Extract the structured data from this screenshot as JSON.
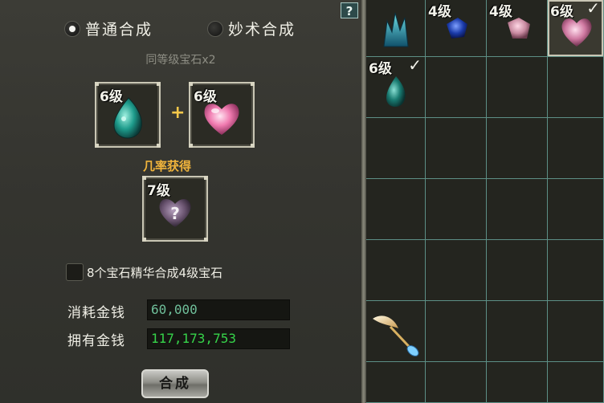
{
  "help": {
    "label": "?"
  },
  "tabs": {
    "normal": "普通合成",
    "magic": "妙术合成",
    "selected": "normal"
  },
  "subtitle": "同等级宝石x2",
  "inputs": [
    {
      "level": "6级",
      "gem": "teal-teardrop-gem-icon"
    },
    {
      "level": "6级",
      "gem": "pink-heart-gem-icon"
    }
  ],
  "plus": "+",
  "result_label": "几率获得",
  "result": {
    "level": "7级",
    "gem": "mystery-gem-icon"
  },
  "essence_option": {
    "label": "8个宝石精华合成4级宝石",
    "checked": false
  },
  "cost": {
    "label": "消耗金钱",
    "value": "60,000"
  },
  "owned": {
    "label": "拥有金钱",
    "value": "117,173,753"
  },
  "synth_button": "合成",
  "inventory": {
    "cells": [
      {
        "level": "",
        "item": "teal-crystal-gem-icon",
        "check": ""
      },
      {
        "level": "4级",
        "item": "blue-gem-icon",
        "check": ""
      },
      {
        "level": "4级",
        "item": "pink-gem-icon",
        "check": ""
      },
      {
        "level": "6级",
        "item": "pink-heart-gem-icon",
        "check": "✓",
        "selected": true
      },
      {
        "level": "6级",
        "item": "teal-teardrop-gem-icon",
        "check": "✓"
      },
      {},
      {},
      {},
      {},
      {},
      {},
      {},
      {},
      {},
      {},
      {},
      {},
      {},
      {},
      {},
      {
        "level": "",
        "item": "feather-pen-icon",
        "check": ""
      },
      {},
      {},
      {},
      {},
      {},
      {},
      {}
    ]
  },
  "colors": {
    "accent_gold": "#f0b43c",
    "money_green": "#36d44a",
    "cost_teal": "#6fbf9a",
    "grid_line": "#5d8f86"
  }
}
